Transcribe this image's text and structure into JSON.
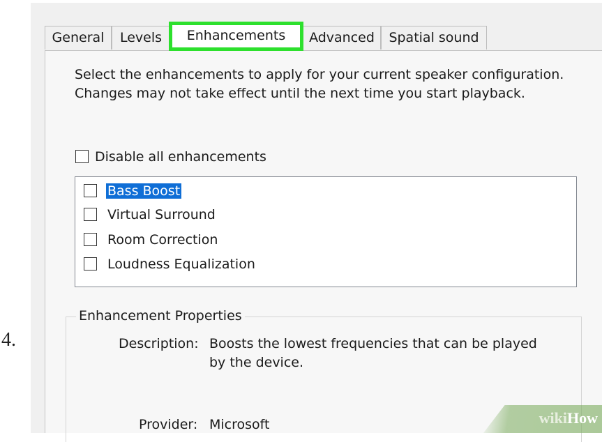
{
  "step_number": "4.",
  "tabs": [
    {
      "label": "General"
    },
    {
      "label": "Levels"
    },
    {
      "label": "Enhancements"
    },
    {
      "label": "Advanced"
    },
    {
      "label": "Spatial sound"
    }
  ],
  "active_tab": "Enhancements",
  "highlight_color": "#2de02d",
  "intro_text": "Select the enhancements to apply for your current speaker configuration. Changes may not take effect until the next time you start playback.",
  "disable_all": {
    "label": "Disable all enhancements",
    "checked": false
  },
  "enhancements": [
    {
      "label": "Bass Boost",
      "checked": false,
      "selected": true
    },
    {
      "label": "Virtual Surround",
      "checked": false,
      "selected": false
    },
    {
      "label": "Room Correction",
      "checked": false,
      "selected": false
    },
    {
      "label": "Loudness Equalization",
      "checked": false,
      "selected": false
    }
  ],
  "properties": {
    "group_title": "Enhancement Properties",
    "description_label": "Description:",
    "description_line1": "Boosts the lowest frequencies that can be played",
    "description_line2": "by the device.",
    "provider_label": "Provider:",
    "provider_value": "Microsoft"
  },
  "watermark": {
    "part1": "wiki",
    "part2": "How"
  }
}
